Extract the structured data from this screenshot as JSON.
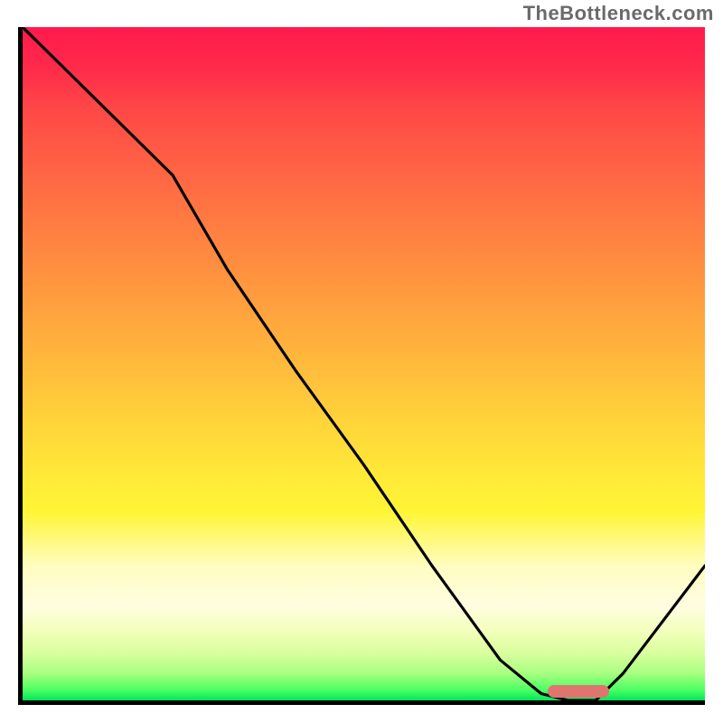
{
  "watermark": "TheBottleneck.com",
  "chart_data": {
    "type": "line",
    "title": "",
    "xlabel": "",
    "ylabel": "",
    "xlim": [
      0,
      100
    ],
    "ylim": [
      0,
      100
    ],
    "grid": false,
    "series": [
      {
        "name": "bottleneck-curve",
        "x": [
          0,
          10,
          20,
          22,
          30,
          40,
          50,
          60,
          70,
          76,
          80,
          84,
          88,
          100
        ],
        "values": [
          100,
          90,
          80,
          78,
          64,
          49,
          35,
          20,
          6,
          1,
          0,
          0,
          4,
          20
        ]
      }
    ],
    "optimal_zone": {
      "x_start": 77,
      "x_end": 86,
      "y": 1.3
    },
    "background_gradient": {
      "stops": [
        {
          "pct": 0,
          "color": "#ff1a4d"
        },
        {
          "pct": 50,
          "color": "#ffc039"
        },
        {
          "pct": 80,
          "color": "#fffdc8"
        },
        {
          "pct": 100,
          "color": "#00e65a"
        }
      ]
    }
  }
}
